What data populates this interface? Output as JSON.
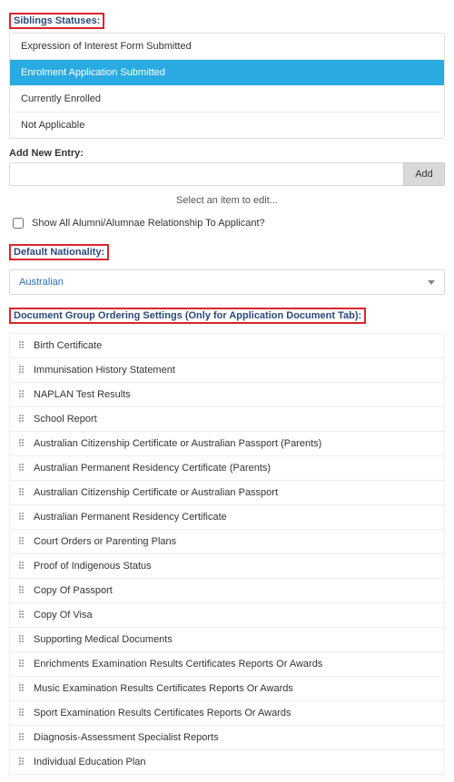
{
  "siblings": {
    "heading": "Siblings Statuses:",
    "items": [
      "Expression of Interest Form Submitted",
      "Enrolment Application Submitted",
      "Currently Enrolled",
      "Not Applicable"
    ],
    "selected_index": 1
  },
  "add_entry": {
    "label": "Add New Entry:",
    "placeholder": "",
    "button": "Add"
  },
  "hint": "Select an item to edit...",
  "alumni_checkbox": {
    "label": "Show All Alumni/Alumnae Relationship To Applicant?",
    "checked": false
  },
  "nationality": {
    "heading": "Default Nationality:",
    "value": "Australian"
  },
  "documents": {
    "heading": "Document Group Ordering Settings (Only for Application Document Tab):",
    "items": [
      "Birth Certificate",
      "Immunisation History Statement",
      "NAPLAN Test Results",
      "School Report",
      "Australian Citizenship Certificate or Australian Passport (Parents)",
      "Australian Permanent Residency Certificate (Parents)",
      "Australian Citizenship Certificate or Australian Passport",
      "Australian Permanent Residency Certificate",
      "Court Orders or Parenting Plans",
      "Proof of Indigenous Status",
      "Copy Of Passport",
      "Copy Of Visa",
      "Supporting Medical Documents",
      "Enrichments Examination Results Certificates Reports Or Awards",
      "Music Examination Results Certificates Reports Or Awards",
      "Sport Examination Results Certificates Reports Or Awards",
      "Diagnosis-Assessment Specialist Reports",
      "Individual Education Plan"
    ]
  }
}
